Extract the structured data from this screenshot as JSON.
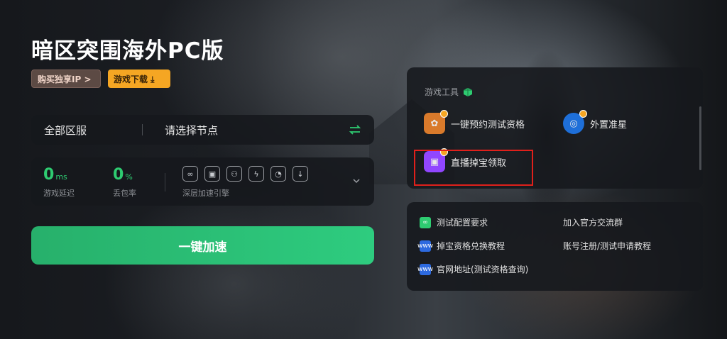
{
  "title": "暗区突围海外PC版",
  "buttons": {
    "buy_ip": "购买独享IP >",
    "download": "游戏下载 ⤓"
  },
  "region": {
    "label": "全部区服",
    "node_placeholder": "请选择节点"
  },
  "stats": {
    "latency": {
      "value": "0",
      "unit": "ms",
      "label": "游戏延迟"
    },
    "loss": {
      "value": "0",
      "unit": "%",
      "label": "丢包率"
    },
    "engine_label": "深层加速引擎"
  },
  "accelerate_label": "一键加速",
  "tools": {
    "title": "游戏工具",
    "items": [
      {
        "label": "一键预约测试资格",
        "icon": "calendar-icon"
      },
      {
        "label": "外置准星",
        "icon": "crosshair-icon"
      },
      {
        "label": "直播掉宝领取",
        "icon": "twitch-icon"
      }
    ]
  },
  "links": [
    {
      "label": "测试配置要求",
      "icon": "link-icon"
    },
    {
      "label": "加入官方交流群",
      "icon": ""
    },
    {
      "label": "掉宝资格兑换教程",
      "icon": "web-icon"
    },
    {
      "label": "账号注册/测试申请教程",
      "icon": ""
    },
    {
      "label": "官网地址(测试资格查询)",
      "icon": "web-icon"
    }
  ],
  "colors": {
    "accent_green": "#2ecc71",
    "download_orange": "#f5a623",
    "highlight_red": "#e0201b"
  }
}
